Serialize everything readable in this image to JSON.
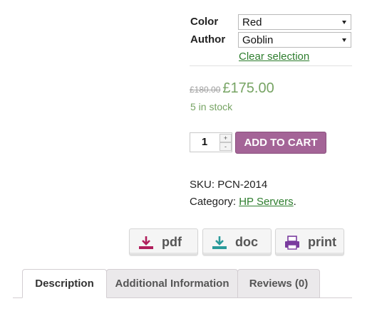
{
  "variations": {
    "color_label": "Color",
    "color_value": "Red",
    "author_label": "Author",
    "author_value": "Goblin",
    "clear_label": "Clear selection"
  },
  "price": {
    "old": "£180.00",
    "current": "£175.00",
    "stock": "5 in stock"
  },
  "cart": {
    "quantity": "1",
    "plus": "+",
    "minus": "-",
    "add_label": "ADD TO CART"
  },
  "meta": {
    "sku_label": "SKU:",
    "sku_value": "PCN-2014",
    "category_label": "Category:",
    "category_value": "HP Servers",
    "category_suffix": "."
  },
  "share": {
    "pdf_label": "pdf",
    "doc_label": "doc",
    "print_label": "print",
    "pdf_color": "#b01e5c",
    "doc_color": "#2a9a9a",
    "print_color": "#7a3b9e"
  },
  "tabs": [
    {
      "label": "Description"
    },
    {
      "label": "Additional Information"
    },
    {
      "label": "Reviews (0)"
    }
  ],
  "colors": {
    "accent": "#a46497",
    "price_green": "#77a464",
    "link_green": "#2d7d2d"
  }
}
